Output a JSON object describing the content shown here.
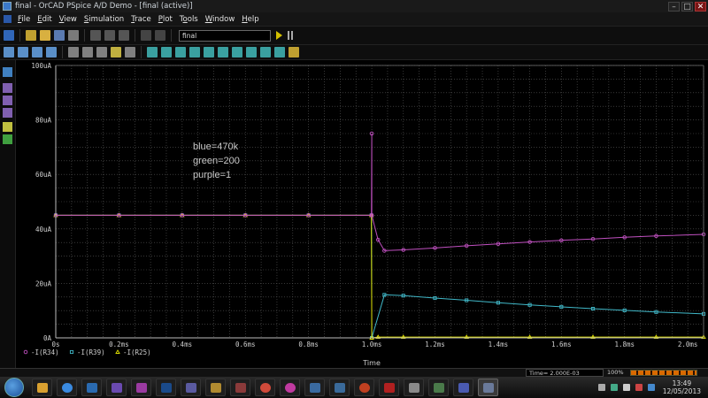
{
  "window": {
    "title": "final - OrCAD PSpice A/D Demo - [final (active)]"
  },
  "window_buttons": {
    "minimize": "–",
    "restore": "□",
    "close": "✕"
  },
  "menubar": {
    "items": [
      {
        "label": "File",
        "mn": "F"
      },
      {
        "label": "Edit",
        "mn": "E"
      },
      {
        "label": "View",
        "mn": "V"
      },
      {
        "label": "Simulation",
        "mn": "S"
      },
      {
        "label": "Trace",
        "mn": "T"
      },
      {
        "label": "Plot",
        "mn": "P"
      },
      {
        "label": "Tools",
        "mn": "o"
      },
      {
        "label": "Window",
        "mn": "W"
      },
      {
        "label": "Help",
        "mn": "H"
      }
    ]
  },
  "toolbar": {
    "profile": "final"
  },
  "annotation": {
    "lines": [
      "blue=470k",
      "green=200",
      "purple=1"
    ]
  },
  "status": {
    "time": "Time= 2.000E-03",
    "zoom": "100%",
    "progress": 1.0
  },
  "clock": {
    "time": "13:49",
    "date": "12/05/2013"
  },
  "chart_data": {
    "type": "line",
    "xlabel": "Time",
    "ylabel": "",
    "xlim": [
      0,
      2.05
    ],
    "ylim": [
      0,
      100
    ],
    "x_ticks": [
      0,
      0.2,
      0.4,
      0.6,
      0.8,
      1.0,
      1.2,
      1.4,
      1.6,
      1.8,
      2.0
    ],
    "x_tick_labels": [
      "0s",
      "0.2ms",
      "0.4ms",
      "0.6ms",
      "0.8ms",
      "1.0ms",
      "1.2ms",
      "1.4ms",
      "1.6ms",
      "1.8ms",
      "2.0ms"
    ],
    "y_ticks": [
      0,
      20,
      40,
      60,
      80,
      100
    ],
    "y_tick_labels": [
      "0A",
      "20uA",
      "40uA",
      "60uA",
      "80uA",
      "100uA"
    ],
    "grid": true,
    "legend_placement": "bottom-left",
    "series": [
      {
        "name": "-I(R34)",
        "color": "#c050c0",
        "marker": "circle",
        "x": [
          0,
          0.2,
          0.4,
          0.6,
          0.8,
          0.999,
          1.0,
          1.0,
          1.02,
          1.04,
          1.1,
          1.2,
          1.3,
          1.4,
          1.5,
          1.6,
          1.7,
          1.8,
          1.9,
          2.05
        ],
        "y": [
          45,
          45,
          45,
          45,
          45,
          45,
          75,
          45,
          36,
          32,
          32.3,
          33,
          33.8,
          34.5,
          35.2,
          35.8,
          36.3,
          36.9,
          37.4,
          38
        ]
      },
      {
        "name": "-I(R39)",
        "color": "#40b8c8",
        "marker": "square",
        "x": [
          0,
          0.2,
          0.4,
          0.6,
          0.8,
          0.999,
          1.0,
          1.04,
          1.1,
          1.2,
          1.3,
          1.4,
          1.5,
          1.6,
          1.7,
          1.8,
          1.9,
          2.05
        ],
        "y": [
          45,
          45,
          45,
          45,
          45,
          45,
          0,
          15.8,
          15.5,
          14.6,
          13.8,
          12.9,
          12.1,
          11.4,
          10.7,
          10.1,
          9.5,
          8.8
        ]
      },
      {
        "name": "-I(R25)",
        "color": "#e0e000",
        "marker": "triangle",
        "x": [
          0,
          0.2,
          0.4,
          0.6,
          0.8,
          0.999,
          1.0,
          1.02,
          1.1,
          1.3,
          1.5,
          1.7,
          1.9,
          2.05
        ],
        "y": [
          45,
          45,
          45,
          45,
          45,
          45,
          0,
          0.3,
          0.3,
          0.3,
          0.3,
          0.3,
          0.3,
          0.3
        ]
      }
    ]
  }
}
